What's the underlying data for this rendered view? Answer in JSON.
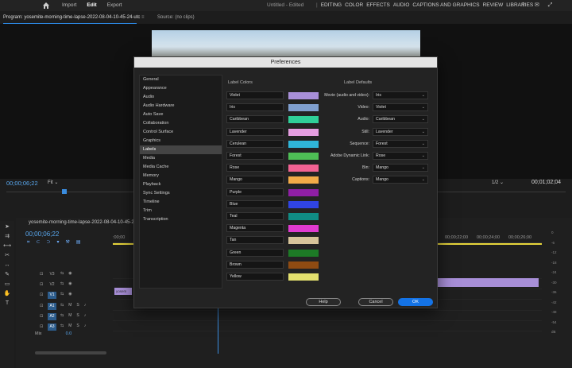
{
  "topbar": {
    "nav": [
      "Import",
      "Edit",
      "Export"
    ],
    "active_nav": "Edit",
    "doc_title": "Untitled - Edited",
    "workspaces": [
      "EDITING",
      "COLOR",
      "EFFECTS",
      "AUDIO",
      "CAPTIONS AND GRAPHICS",
      "REVIEW",
      "LIBRARIES"
    ],
    "icons": [
      "export-icon",
      "notification-icon",
      "fullscreen-icon"
    ]
  },
  "panel_tabs": {
    "program": "Program: yosemite-morning-time-lapse-2022-08-04-10-45-24-utc",
    "source": "Source: (no clips)"
  },
  "monitor": {
    "timecode": "00;00;06;22",
    "zoom": "Fit",
    "resolution": "1/2",
    "duration": "00;01;02;04"
  },
  "timeline": {
    "sequence_name": "yosemite-morning-time-lapse-2022-08-04-10-45-24-...",
    "timecode": "00;00;06;22",
    "ruler": [
      ":00;00",
      "00;00;22;00",
      "00;00;24;00",
      "00;00;26;00"
    ],
    "tracks": [
      {
        "name": "V3",
        "selected": false
      },
      {
        "name": "V2",
        "selected": false
      },
      {
        "name": "V1",
        "selected": true
      },
      {
        "name": "A1",
        "selected": true
      },
      {
        "name": "A2",
        "selected": true
      },
      {
        "name": "A3",
        "selected": true
      }
    ],
    "mix_label": "Mix",
    "mix_value": "0.0",
    "clip_label": "yosem",
    "meter_labels": [
      "0",
      "-6",
      "-12",
      "-18",
      "-24",
      "-30",
      "-36",
      "-42",
      "-48",
      "-54",
      "dB"
    ]
  },
  "preferences": {
    "title": "Preferences",
    "categories": [
      "General",
      "Appearance",
      "Audio",
      "Audio Hardware",
      "Auto Save",
      "Collaboration",
      "Control Surface",
      "Graphics",
      "Labels",
      "Media",
      "Media Cache",
      "Memory",
      "Playback",
      "Sync Settings",
      "Timeline",
      "Trim",
      "Transcription"
    ],
    "selected_category": "Labels",
    "label_colors_heading": "Label Colors",
    "label_defaults_heading": "Label Defaults",
    "label_colors": [
      {
        "name": "Violet",
        "color": "#a88fd8"
      },
      {
        "name": "Iris",
        "color": "#7f9fcf"
      },
      {
        "name": "Caribbean",
        "color": "#2fcf99"
      },
      {
        "name": "Lavender",
        "color": "#e59ee0"
      },
      {
        "name": "Cerulean",
        "color": "#2fb5d8"
      },
      {
        "name": "Forest",
        "color": "#4ebe55"
      },
      {
        "name": "Rose",
        "color": "#f26293"
      },
      {
        "name": "Mango",
        "color": "#f2ab48"
      },
      {
        "name": "Purple",
        "color": "#8f1fa5"
      },
      {
        "name": "Blue",
        "color": "#3044e2"
      },
      {
        "name": "Teal",
        "color": "#108c84"
      },
      {
        "name": "Magenta",
        "color": "#e03ad0"
      },
      {
        "name": "Tan",
        "color": "#d6c49a"
      },
      {
        "name": "Green",
        "color": "#1d7a26"
      },
      {
        "name": "Brown",
        "color": "#8f4b12"
      },
      {
        "name": "Yellow",
        "color": "#e3e06e"
      }
    ],
    "label_defaults": [
      {
        "label": "Movie (audio and video):",
        "value": "Iris"
      },
      {
        "label": "Video:",
        "value": "Violet"
      },
      {
        "label": "Audio:",
        "value": "Caribbean"
      },
      {
        "label": "Still:",
        "value": "Lavender"
      },
      {
        "label": "Sequence:",
        "value": "Forest"
      },
      {
        "label": "Adobe Dynamic Link:",
        "value": "Rose"
      },
      {
        "label": "Bin:",
        "value": "Mango"
      },
      {
        "label": "Captions:",
        "value": "Mango"
      }
    ],
    "buttons": {
      "help": "Help",
      "cancel": "Cancel",
      "ok": "OK"
    }
  }
}
